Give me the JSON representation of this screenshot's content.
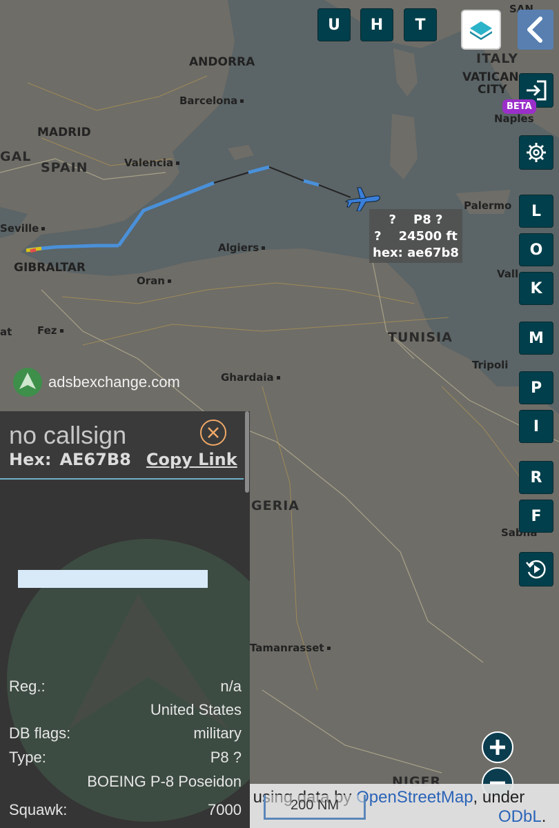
{
  "top_buttons": [
    "U",
    "H",
    "T"
  ],
  "side_buttons": [
    "L",
    "O",
    "K",
    "M",
    "P",
    "I",
    "R",
    "F"
  ],
  "beta_label": "BETA",
  "map_labels": {
    "andorra": "ANDORRA",
    "barcelona": "Barcelona",
    "madrid": "MADRID",
    "spain": "SPAIN",
    "gal": "GAL",
    "valencia": "Valencia",
    "seville": "Seville",
    "gibraltar": "GIBRALTAR",
    "algiers": "Algiers",
    "oran": "Oran",
    "fez": "Fez",
    "at": "at",
    "italy": "ITALY",
    "vatican": "VATICAN",
    "city": "CITY",
    "naples": "Naples",
    "palermo": "Palermo",
    "vall": "Vall",
    "tunisia": "TUNISIA",
    "tripoli": "Tripoli",
    "ghardaia": "Ghardaia",
    "geria": "GERIA",
    "sabha": "Sabha",
    "tamanrasset": "Tamanrasset",
    "niger": "NIGER",
    "san": "SAN"
  },
  "aircraft_label": {
    "line1": "?    P8 ?",
    "line2": "?    24500 ft",
    "line3": "hex: ae67b8"
  },
  "watermark": "adsbexchange.com",
  "panel": {
    "callsign": "no callsign",
    "hex_label": "Hex:",
    "hex_value": "AE67B8",
    "copy_link": "Copy Link",
    "rows": [
      {
        "key": "Reg.:",
        "value": "n/a"
      },
      {
        "key": "",
        "value": "United States"
      },
      {
        "key": "DB flags:",
        "value": "military"
      },
      {
        "key": "Type:",
        "value": "P8 ?"
      },
      {
        "key": "",
        "value": "BOEING P-8 Poseidon"
      },
      {
        "key": "Squawk:",
        "value": "7000"
      }
    ]
  },
  "attribution": {
    "prefix": "m using data by ",
    "link": "OpenStreetMap",
    "suffix": ", under",
    "license": "ODbL",
    "end": "."
  },
  "scale_label": "200 NM",
  "colors": {
    "button_bg": "#003f4b",
    "track_blue": "#4a90d9",
    "aircraft": "#3a7fd9",
    "beta": "#9b2fc9",
    "panel_bg": "#353535",
    "close_ring": "#f0a868"
  },
  "icons": {
    "layers": "layers-icon",
    "back": "chevron-left-icon",
    "login": "login-icon",
    "settings": "gear-icon",
    "replay": "replay-icon",
    "close": "close-icon",
    "zoom_in": "plus-icon",
    "zoom_out": "minus-icon",
    "aircraft": "airplane-icon"
  }
}
